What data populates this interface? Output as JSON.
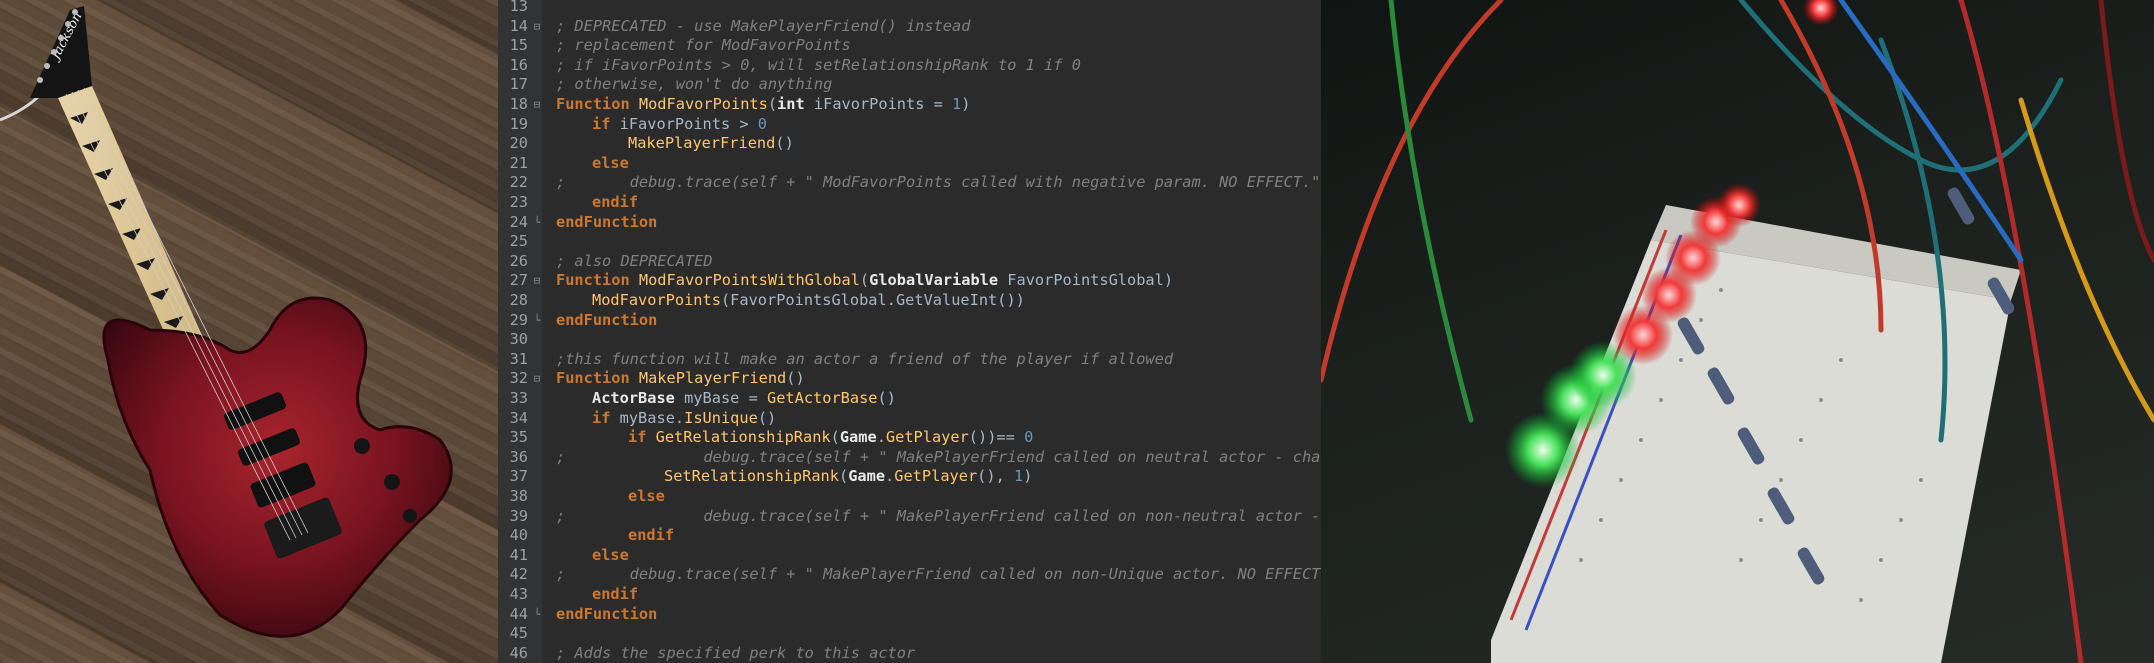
{
  "photos": {
    "left": {
      "subject": "guitar-on-wood-floor",
      "headstock_logo": "Jackson"
    },
    "right": {
      "subject": "breadboard-with-leds"
    }
  },
  "colors": {
    "editor_bg": "#2b2b2b",
    "gutter_bg": "#313335",
    "keyword": "#cc7832",
    "comment": "#808080",
    "function_name": "#ffc66d",
    "number": "#6897bb",
    "text": "#a9b7c6"
  },
  "editor": {
    "lines": [
      {
        "num": "13",
        "fold": "",
        "parts": []
      },
      {
        "num": "14",
        "fold": "⊟",
        "parts": [
          {
            "t": "com",
            "v": "; DEPRECATED - use MakePlayerFriend() instead"
          }
        ]
      },
      {
        "num": "15",
        "fold": "",
        "parts": [
          {
            "t": "com",
            "v": "; replacement for ModFavorPoints"
          }
        ]
      },
      {
        "num": "16",
        "fold": "",
        "parts": [
          {
            "t": "com",
            "v": "; if iFavorPoints > 0, will setRelationshipRank to 1 if 0"
          }
        ]
      },
      {
        "num": "17",
        "fold": "",
        "parts": [
          {
            "t": "com",
            "v": "; otherwise, won't do anything"
          }
        ]
      },
      {
        "num": "18",
        "fold": "⊟",
        "parts": [
          {
            "t": "kw",
            "v": "Function "
          },
          {
            "t": "fn",
            "v": "ModFavorPoints"
          },
          {
            "t": "op",
            "v": "("
          },
          {
            "t": "type",
            "v": "int"
          },
          {
            "t": "var",
            "v": " iFavorPoints "
          },
          {
            "t": "op",
            "v": "= "
          },
          {
            "t": "num",
            "v": "1"
          },
          {
            "t": "op",
            "v": ")"
          }
        ]
      },
      {
        "num": "19",
        "fold": "",
        "indent": 1,
        "parts": [
          {
            "t": "kw",
            "v": "if "
          },
          {
            "t": "var",
            "v": "iFavorPoints "
          },
          {
            "t": "op",
            "v": "> "
          },
          {
            "t": "num",
            "v": "0"
          }
        ]
      },
      {
        "num": "20",
        "fold": "",
        "indent": 2,
        "parts": [
          {
            "t": "call",
            "v": "MakePlayerFriend"
          },
          {
            "t": "op",
            "v": "()"
          }
        ]
      },
      {
        "num": "21",
        "fold": "",
        "indent": 1,
        "parts": [
          {
            "t": "kw",
            "v": "else"
          }
        ]
      },
      {
        "num": "22",
        "fold": "",
        "parts": [
          {
            "t": "com",
            "v": ";       debug.trace(self + \" ModFavorPoints called with negative param. NO EFFECT.\")"
          }
        ]
      },
      {
        "num": "23",
        "fold": "",
        "indent": 1,
        "parts": [
          {
            "t": "kw",
            "v": "endif"
          }
        ]
      },
      {
        "num": "24",
        "fold": "└",
        "parts": [
          {
            "t": "kw",
            "v": "endFunction"
          }
        ]
      },
      {
        "num": "25",
        "fold": "",
        "parts": []
      },
      {
        "num": "26",
        "fold": "",
        "parts": [
          {
            "t": "com",
            "v": "; also DEPRECATED"
          }
        ]
      },
      {
        "num": "27",
        "fold": "⊟",
        "parts": [
          {
            "t": "kw",
            "v": "Function "
          },
          {
            "t": "fn",
            "v": "ModFavorPointsWithGlobal"
          },
          {
            "t": "op",
            "v": "("
          },
          {
            "t": "type",
            "v": "GlobalVariable"
          },
          {
            "t": "var",
            "v": " FavorPointsGlobal"
          },
          {
            "t": "op",
            "v": ")"
          }
        ]
      },
      {
        "num": "28",
        "fold": "",
        "indent": 1,
        "parts": [
          {
            "t": "call",
            "v": "ModFavorPoints"
          },
          {
            "t": "op",
            "v": "("
          },
          {
            "t": "var",
            "v": "FavorPointsGlobal"
          },
          {
            "t": "op",
            "v": "."
          },
          {
            "t": "var",
            "v": "GetValueInt"
          },
          {
            "t": "op",
            "v": "())"
          }
        ]
      },
      {
        "num": "29",
        "fold": "└",
        "parts": [
          {
            "t": "kw",
            "v": "endFunction"
          }
        ]
      },
      {
        "num": "30",
        "fold": "",
        "parts": []
      },
      {
        "num": "31",
        "fold": "",
        "parts": [
          {
            "t": "com",
            "v": ";this function will make an actor a friend of the player if allowed"
          }
        ]
      },
      {
        "num": "32",
        "fold": "⊟",
        "parts": [
          {
            "t": "kw",
            "v": "Function "
          },
          {
            "t": "fn",
            "v": "MakePlayerFriend"
          },
          {
            "t": "op",
            "v": "()"
          }
        ]
      },
      {
        "num": "33",
        "fold": "",
        "indent": 1,
        "parts": [
          {
            "t": "type",
            "v": "ActorBase"
          },
          {
            "t": "var",
            "v": " myBase "
          },
          {
            "t": "op",
            "v": "= "
          },
          {
            "t": "call",
            "v": "GetActorBase"
          },
          {
            "t": "op",
            "v": "()"
          }
        ]
      },
      {
        "num": "34",
        "fold": "",
        "indent": 1,
        "parts": [
          {
            "t": "kw",
            "v": "if "
          },
          {
            "t": "var",
            "v": "myBase"
          },
          {
            "t": "op",
            "v": "."
          },
          {
            "t": "call",
            "v": "IsUnique"
          },
          {
            "t": "op",
            "v": "()"
          }
        ]
      },
      {
        "num": "35",
        "fold": "",
        "indent": 2,
        "parts": [
          {
            "t": "kw",
            "v": "if "
          },
          {
            "t": "call",
            "v": "GetRelationshipRank"
          },
          {
            "t": "op",
            "v": "("
          },
          {
            "t": "type",
            "v": "Game"
          },
          {
            "t": "op",
            "v": "."
          },
          {
            "t": "call",
            "v": "GetPlayer"
          },
          {
            "t": "op",
            "v": "())== "
          },
          {
            "t": "num",
            "v": "0"
          }
        ]
      },
      {
        "num": "36",
        "fold": "",
        "parts": [
          {
            "t": "com",
            "v": ";               debug.trace(self + \" MakePlayerFriend called on neutral actor - changed to"
          }
        ]
      },
      {
        "num": "37",
        "fold": "",
        "indent": 3,
        "parts": [
          {
            "t": "call",
            "v": "SetRelationshipRank"
          },
          {
            "t": "op",
            "v": "("
          },
          {
            "t": "type",
            "v": "Game"
          },
          {
            "t": "op",
            "v": "."
          },
          {
            "t": "call",
            "v": "GetPlayer"
          },
          {
            "t": "op",
            "v": "(), "
          },
          {
            "t": "num",
            "v": "1"
          },
          {
            "t": "op",
            "v": ")"
          }
        ]
      },
      {
        "num": "38",
        "fold": "",
        "indent": 2,
        "parts": [
          {
            "t": "kw",
            "v": "else"
          }
        ]
      },
      {
        "num": "39",
        "fold": "",
        "parts": [
          {
            "t": "com",
            "v": ";               debug.trace(self + \" MakePlayerFriend called on non-neutral actor - NO EFF"
          }
        ]
      },
      {
        "num": "40",
        "fold": "",
        "indent": 2,
        "parts": [
          {
            "t": "kw",
            "v": "endif"
          }
        ]
      },
      {
        "num": "41",
        "fold": "",
        "indent": 1,
        "parts": [
          {
            "t": "kw",
            "v": "else"
          }
        ]
      },
      {
        "num": "42",
        "fold": "",
        "parts": [
          {
            "t": "com",
            "v": ";       debug.trace(self + \" MakePlayerFriend called on non-Unique actor. NO EFFECT.\")"
          }
        ]
      },
      {
        "num": "43",
        "fold": "",
        "indent": 1,
        "parts": [
          {
            "t": "kw",
            "v": "endif"
          }
        ]
      },
      {
        "num": "44",
        "fold": "└",
        "parts": [
          {
            "t": "kw",
            "v": "endFunction"
          }
        ]
      },
      {
        "num": "45",
        "fold": "",
        "parts": []
      },
      {
        "num": "46",
        "fold": "",
        "parts": [
          {
            "t": "com",
            "v": "; Adds the specified perk to this actor"
          }
        ]
      }
    ]
  }
}
